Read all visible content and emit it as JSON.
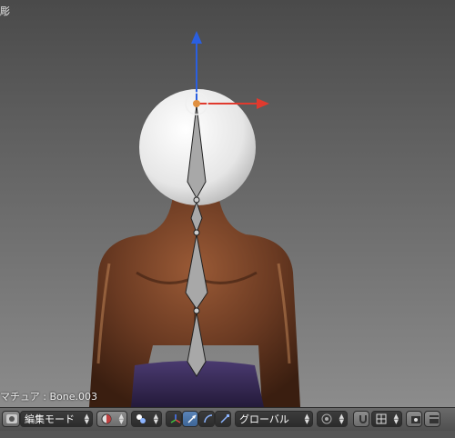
{
  "viewport": {
    "corner_label": "彫",
    "status_label": "マチュア : Bone.003"
  },
  "header": {
    "mode_label": "編集モード",
    "orientation_label": "グローバル"
  },
  "colors": {
    "manipulator_x": "#e03a2e",
    "manipulator_z": "#2a5fe0",
    "bone": "#a8a8a8",
    "body_skin": "#6a3a22",
    "pants": "#3a2e5a",
    "active_button": "#5a84b8"
  },
  "icons": [
    "editor-type-icon",
    "viewport-shading-icon",
    "pivot-icon",
    "manipulator-toggle-icon",
    "translate-icon",
    "rotate-icon",
    "scale-icon",
    "proportional-icon",
    "snap-icon",
    "snap-element-icon",
    "render-icon",
    "render-anim-icon"
  ]
}
